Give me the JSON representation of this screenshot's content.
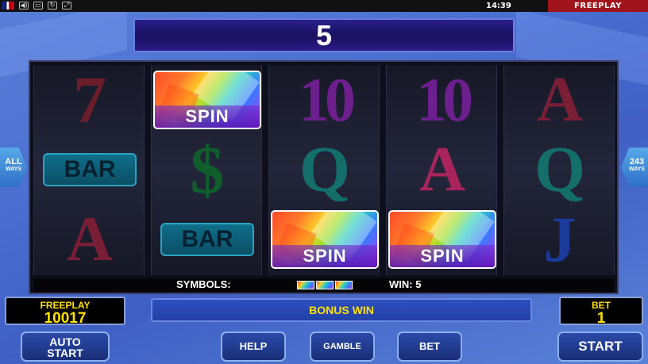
{
  "status_bar": {
    "clock": "14:39",
    "mode_tab": "FREEPLAY"
  },
  "win_display": {
    "value": "5"
  },
  "reels": [
    [
      {
        "kind": "seven",
        "text": "7"
      },
      {
        "kind": "bar",
        "text": "BAR"
      },
      {
        "kind": "A-red",
        "text": "A"
      }
    ],
    [
      {
        "kind": "spin",
        "text": "SPIN"
      },
      {
        "kind": "dollar",
        "text": "$"
      },
      {
        "kind": "bar",
        "text": "BAR"
      }
    ],
    [
      {
        "kind": "ten",
        "text": "10"
      },
      {
        "kind": "Q",
        "text": "Q"
      },
      {
        "kind": "spin",
        "text": "SPIN"
      }
    ],
    [
      {
        "kind": "ten",
        "text": "10"
      },
      {
        "kind": "A-pink",
        "text": "A"
      },
      {
        "kind": "spin",
        "text": "SPIN"
      }
    ],
    [
      {
        "kind": "A-red",
        "text": "A"
      },
      {
        "kind": "Q",
        "text": "Q"
      },
      {
        "kind": "J",
        "text": "J"
      }
    ]
  ],
  "info_strip": {
    "symbols_label": "SYMBOLS:",
    "win_label": "WIN: 5"
  },
  "side_left": {
    "line1": "ALL",
    "line2": "WAYS"
  },
  "side_right": {
    "line1": "243",
    "line2": "WAYS"
  },
  "freeplay_panel": {
    "caption": "FREEPLAY",
    "value": "10017"
  },
  "message": "BONUS WIN",
  "bet_panel": {
    "caption": "BET",
    "value": "1"
  },
  "buttons": {
    "auto_start_line1": "AUTO",
    "auto_start_line2": "START",
    "help": "HELP",
    "gamble": "GAMBLE",
    "bet": "BET",
    "start": "START"
  },
  "colors": {
    "background": "#4a6fd0",
    "panel_text": "#ffe200",
    "freeplay_tab": "#a0141c"
  }
}
